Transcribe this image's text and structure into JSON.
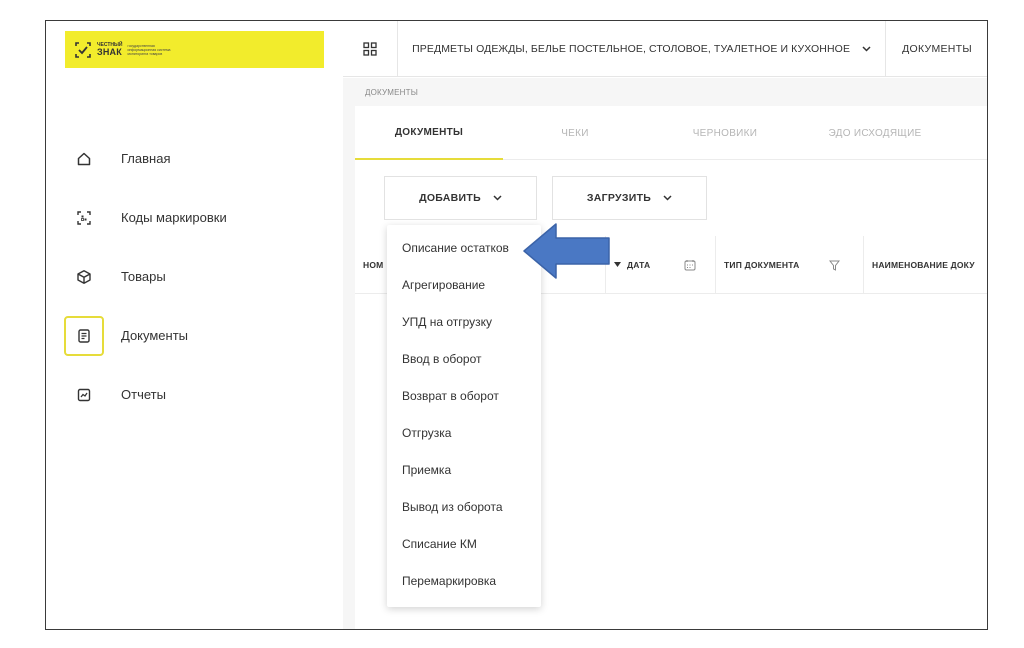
{
  "logo": {
    "small": "ЧЕСТНЫЙ",
    "big": "ЗНАК",
    "tagline": "государственная информационная система мониторинга товаров"
  },
  "sidebar": {
    "items": [
      {
        "label": "Главная",
        "icon": "home-icon"
      },
      {
        "label": "Коды маркировки",
        "icon": "qr-scan-icon"
      },
      {
        "label": "Товары",
        "icon": "box-icon"
      },
      {
        "label": "Документы",
        "icon": "document-icon",
        "active": true
      },
      {
        "label": "Отчеты",
        "icon": "chart-icon"
      }
    ]
  },
  "topbar": {
    "category": "ПРЕДМЕТЫ ОДЕЖДЫ, БЕЛЬЕ ПОСТЕЛЬНОЕ, СТОЛОВОЕ, ТУАЛЕТНОЕ И КУХОННОЕ",
    "docs_link": "ДОКУМЕНТЫ"
  },
  "breadcrumb": "ДОКУМЕНТЫ",
  "tabs": [
    {
      "label": "ДОКУМЕНТЫ",
      "active": true
    },
    {
      "label": "ЧЕКИ"
    },
    {
      "label": "ЧЕРНОВИКИ"
    },
    {
      "label": "ЭДО ИСХОДЯЩИЕ"
    }
  ],
  "toolbar": {
    "add_label": "ДОБАВИТЬ",
    "upload_label": "ЗАГРУЗИТЬ"
  },
  "table": {
    "columns": [
      "НОМ",
      "ДАТА",
      "ТИП ДОКУМЕНТА",
      "НАИМЕНОВАНИЕ ДОКУ"
    ]
  },
  "dropdown": {
    "items": [
      "Описание остатков",
      "Агрегирование",
      "УПД на отгрузку",
      "Ввод в оборот",
      "Возврат в оборот",
      "Отгрузка",
      "Приемка",
      "Вывод из оборота",
      "Списание КМ",
      "Перемаркировка"
    ]
  },
  "colors": {
    "brand_yellow": "#f2ec2c",
    "accent_yellow": "#e6dc3a",
    "arrow_blue": "#4a78c4"
  }
}
